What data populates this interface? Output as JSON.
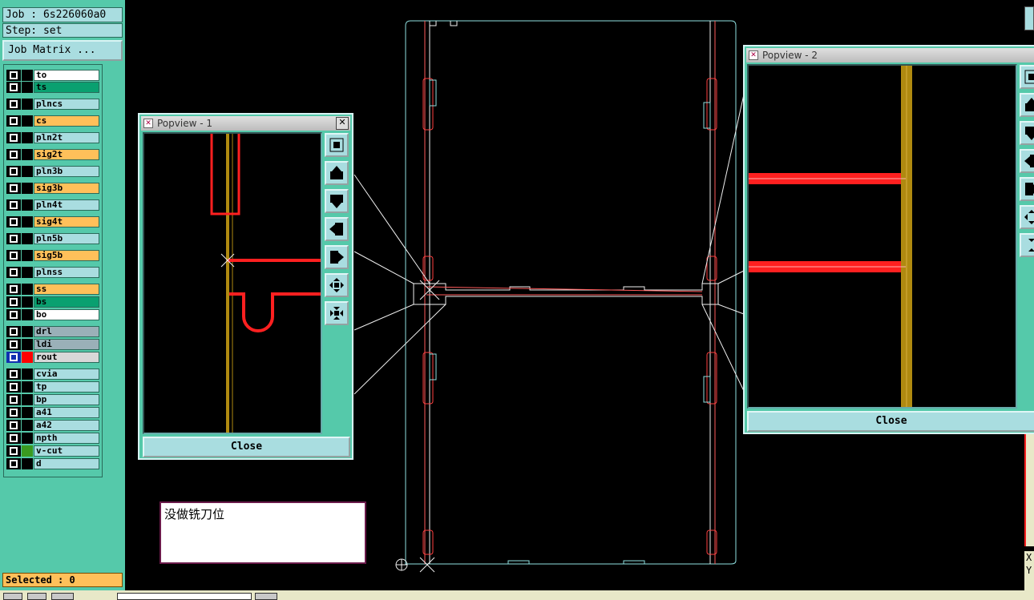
{
  "job": {
    "label": "Job : 6s226060a0",
    "step": "Step: set",
    "matrix_button": "Job Matrix ..."
  },
  "layers": [
    {
      "name": "to",
      "color": "#ffffff",
      "swatch": "#000000"
    },
    {
      "name": "ts",
      "color": "#0aa070",
      "swatch": "#000000"
    },
    {
      "name": "plncs",
      "color": "#a9dde0",
      "swatch": "#000000"
    },
    {
      "name": "cs",
      "color": "#ffc05a",
      "swatch": "#000000"
    },
    {
      "name": "pln2t",
      "color": "#a9dde0",
      "swatch": "#000000"
    },
    {
      "name": "sig2t",
      "color": "#ffc05a",
      "swatch": "#000000"
    },
    {
      "name": "pln3b",
      "color": "#a9dde0",
      "swatch": "#000000"
    },
    {
      "name": "sig3b",
      "color": "#ffc05a",
      "swatch": "#000000"
    },
    {
      "name": "pln4t",
      "color": "#a9dde0",
      "swatch": "#000000"
    },
    {
      "name": "sig4t",
      "color": "#ffc05a",
      "swatch": "#000000"
    },
    {
      "name": "pln5b",
      "color": "#a9dde0",
      "swatch": "#000000"
    },
    {
      "name": "sig5b",
      "color": "#ffc05a",
      "swatch": "#000000"
    },
    {
      "name": "plnss",
      "color": "#a9dde0",
      "swatch": "#000000"
    },
    {
      "name": "ss",
      "color": "#ffc05a",
      "swatch": "#000000"
    },
    {
      "name": "bs",
      "color": "#0aa070",
      "swatch": "#000000"
    },
    {
      "name": "bo",
      "color": "#ffffff",
      "swatch": "#000000"
    },
    {
      "name": "drl",
      "color": "#9ab0b8",
      "swatch": "#000000"
    },
    {
      "name": "ldi",
      "color": "#9ab0b8",
      "swatch": "#000000"
    },
    {
      "name": "rout",
      "color": "#d8d8d8",
      "swatch": "#ff0000",
      "active": true
    },
    {
      "name": "cvia",
      "color": "#a9dde0",
      "swatch": "#000000"
    },
    {
      "name": "tp",
      "color": "#a9dde0",
      "swatch": "#000000"
    },
    {
      "name": "bp",
      "color": "#a9dde0",
      "swatch": "#000000"
    },
    {
      "name": "a41",
      "color": "#a9dde0",
      "swatch": "#000000"
    },
    {
      "name": "a42",
      "color": "#a9dde0",
      "swatch": "#000000"
    },
    {
      "name": "npth",
      "color": "#a9dde0",
      "swatch": "#000000"
    },
    {
      "name": "v-cut",
      "color": "#a9dde0",
      "swatch": "#3a9a20"
    },
    {
      "name": "d",
      "color": "#a9dde0",
      "swatch": "#000000"
    }
  ],
  "status": {
    "selected": "Selected : 0"
  },
  "popview1": {
    "title": "Popview - 1",
    "close": "Close"
  },
  "popview2": {
    "title": "Popview - 2",
    "close": "Close"
  },
  "note": {
    "text": "没做铣刀位"
  },
  "coords": {
    "x_label": "X",
    "y_label": "Y"
  }
}
